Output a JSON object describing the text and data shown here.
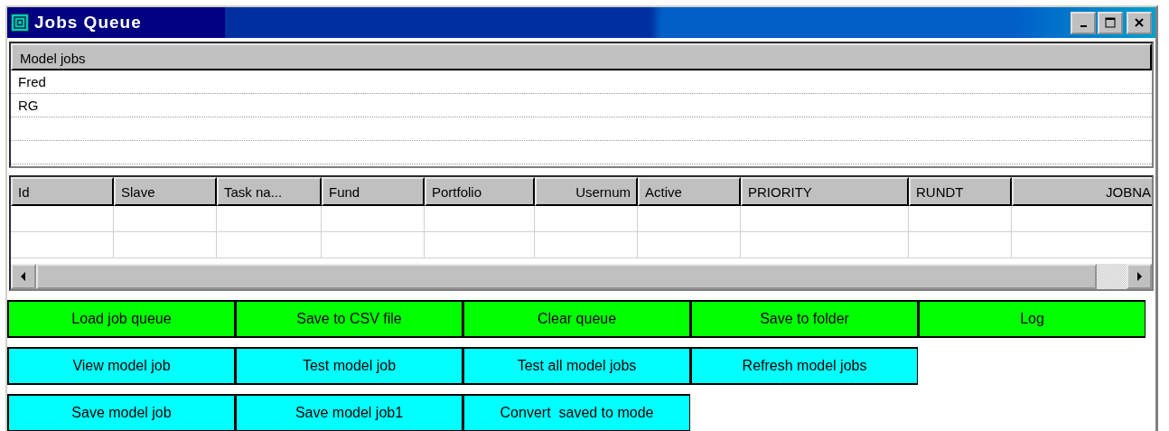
{
  "window": {
    "title": "Jobs Queue"
  },
  "model_jobs": {
    "header": "Model jobs",
    "items": [
      "Fred",
      "RG"
    ]
  },
  "table": {
    "columns": [
      {
        "label": "Id"
      },
      {
        "label": "Slave"
      },
      {
        "label": "Task na..."
      },
      {
        "label": "Fund"
      },
      {
        "label": "Portfolio"
      },
      {
        "label": "Usernum"
      },
      {
        "label": "Active"
      },
      {
        "label": "PRIORITY"
      },
      {
        "label": "RUNDT"
      },
      {
        "label": "JOBNA"
      }
    ]
  },
  "button_rows": [
    [
      {
        "label": "Load job queue",
        "color": "#00ff00"
      },
      {
        "label": "Save to CSV file",
        "color": "#00ff00"
      },
      {
        "label": "Clear queue",
        "color": "#00ff00"
      },
      {
        "label": "Save to folder",
        "color": "#00ff00"
      },
      {
        "label": "Log",
        "color": "#00ff00"
      }
    ],
    [
      {
        "label": "View model job",
        "color": "#00ffff"
      },
      {
        "label": "Test model job",
        "color": "#00ffff"
      },
      {
        "label": "Test all model jobs",
        "color": "#00ffff"
      },
      {
        "label": "Refresh model jobs",
        "color": "#00ffff"
      }
    ],
    [
      {
        "label": "Save model job",
        "color": "#00ffff"
      },
      {
        "label": "Save model job1",
        "color": "#00ffff"
      },
      {
        "label": "Convert  saved to mode",
        "color": "#00ffff"
      }
    ]
  ]
}
